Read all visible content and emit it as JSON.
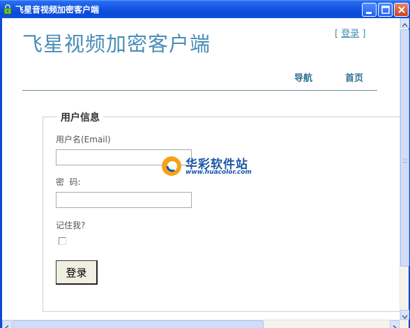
{
  "window": {
    "title": "飞星音视频加密客户端"
  },
  "header": {
    "site_title": "飞星视频加密客户端",
    "login_bracket_open": "[",
    "login_link": "登录",
    "login_bracket_close": "]",
    "nav": [
      {
        "label": "导航"
      },
      {
        "label": "首页"
      }
    ]
  },
  "login_form": {
    "legend": "用户信息",
    "username_label": "用户名(Email)",
    "username_value": "",
    "password_label": "密  码:",
    "password_value": "",
    "remember_label": "记住我?",
    "remember_checked": false,
    "submit_label": "登录"
  },
  "watermark": {
    "text": "华彩软件站",
    "url": "www.huacolor.com"
  },
  "colors": {
    "title_bar": "#0a4ad6",
    "site_title": "#4a8db7",
    "nav_text": "#2f6f93"
  }
}
